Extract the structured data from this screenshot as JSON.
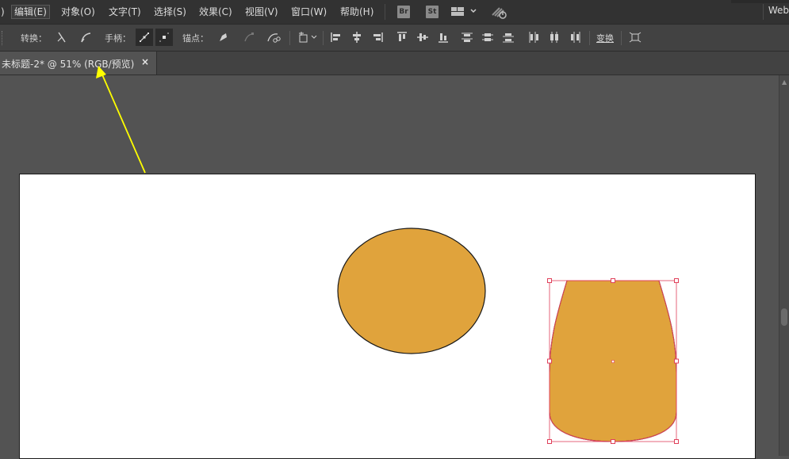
{
  "menubar": {
    "items": [
      {
        "label": ")",
        "name": "menu-item-truncated"
      },
      {
        "label": "编辑(E)",
        "name": "menu-edit"
      },
      {
        "label": "对象(O)",
        "name": "menu-object"
      },
      {
        "label": "文字(T)",
        "name": "menu-type"
      },
      {
        "label": "选择(S)",
        "name": "menu-select"
      },
      {
        "label": "效果(C)",
        "name": "menu-effect"
      },
      {
        "label": "视图(V)",
        "name": "menu-view"
      },
      {
        "label": "窗口(W)",
        "name": "menu-window"
      },
      {
        "label": "帮助(H)",
        "name": "menu-help"
      }
    ],
    "bridge_label": "Br",
    "stock_label": "St",
    "workspace_label": "Web"
  },
  "controlbar": {
    "convert_label": "转换：",
    "handles_label": "手柄：",
    "anchors_label": "锚点：",
    "transform_label": "变换"
  },
  "document": {
    "tab_title": "未标题-2* @ 51% (RGB/预览)",
    "close_glyph": "×"
  },
  "colors": {
    "shape_fill": "#E0A33C",
    "selection": "#E0405A",
    "annotation_arrow": "#FFFF00",
    "artboard": "#FFFFFF",
    "workspace": "#535353"
  },
  "icons": [
    "convert-anchor-corner-icon",
    "convert-anchor-smooth-icon",
    "show-handles-icon",
    "hide-handles-icon",
    "anchor-pen-icon",
    "connect-anchors-icon",
    "cut-path-icon",
    "transform-reference-icon",
    "align-left-icon",
    "align-hcenter-icon",
    "align-right-icon",
    "align-top-icon",
    "align-vcenter-icon",
    "align-bottom-icon",
    "distribute-top-icon",
    "distribute-vcenter-icon",
    "distribute-bottom-icon",
    "distribute-left-icon",
    "distribute-hcenter-icon",
    "distribute-right-icon",
    "isolate-icon"
  ]
}
